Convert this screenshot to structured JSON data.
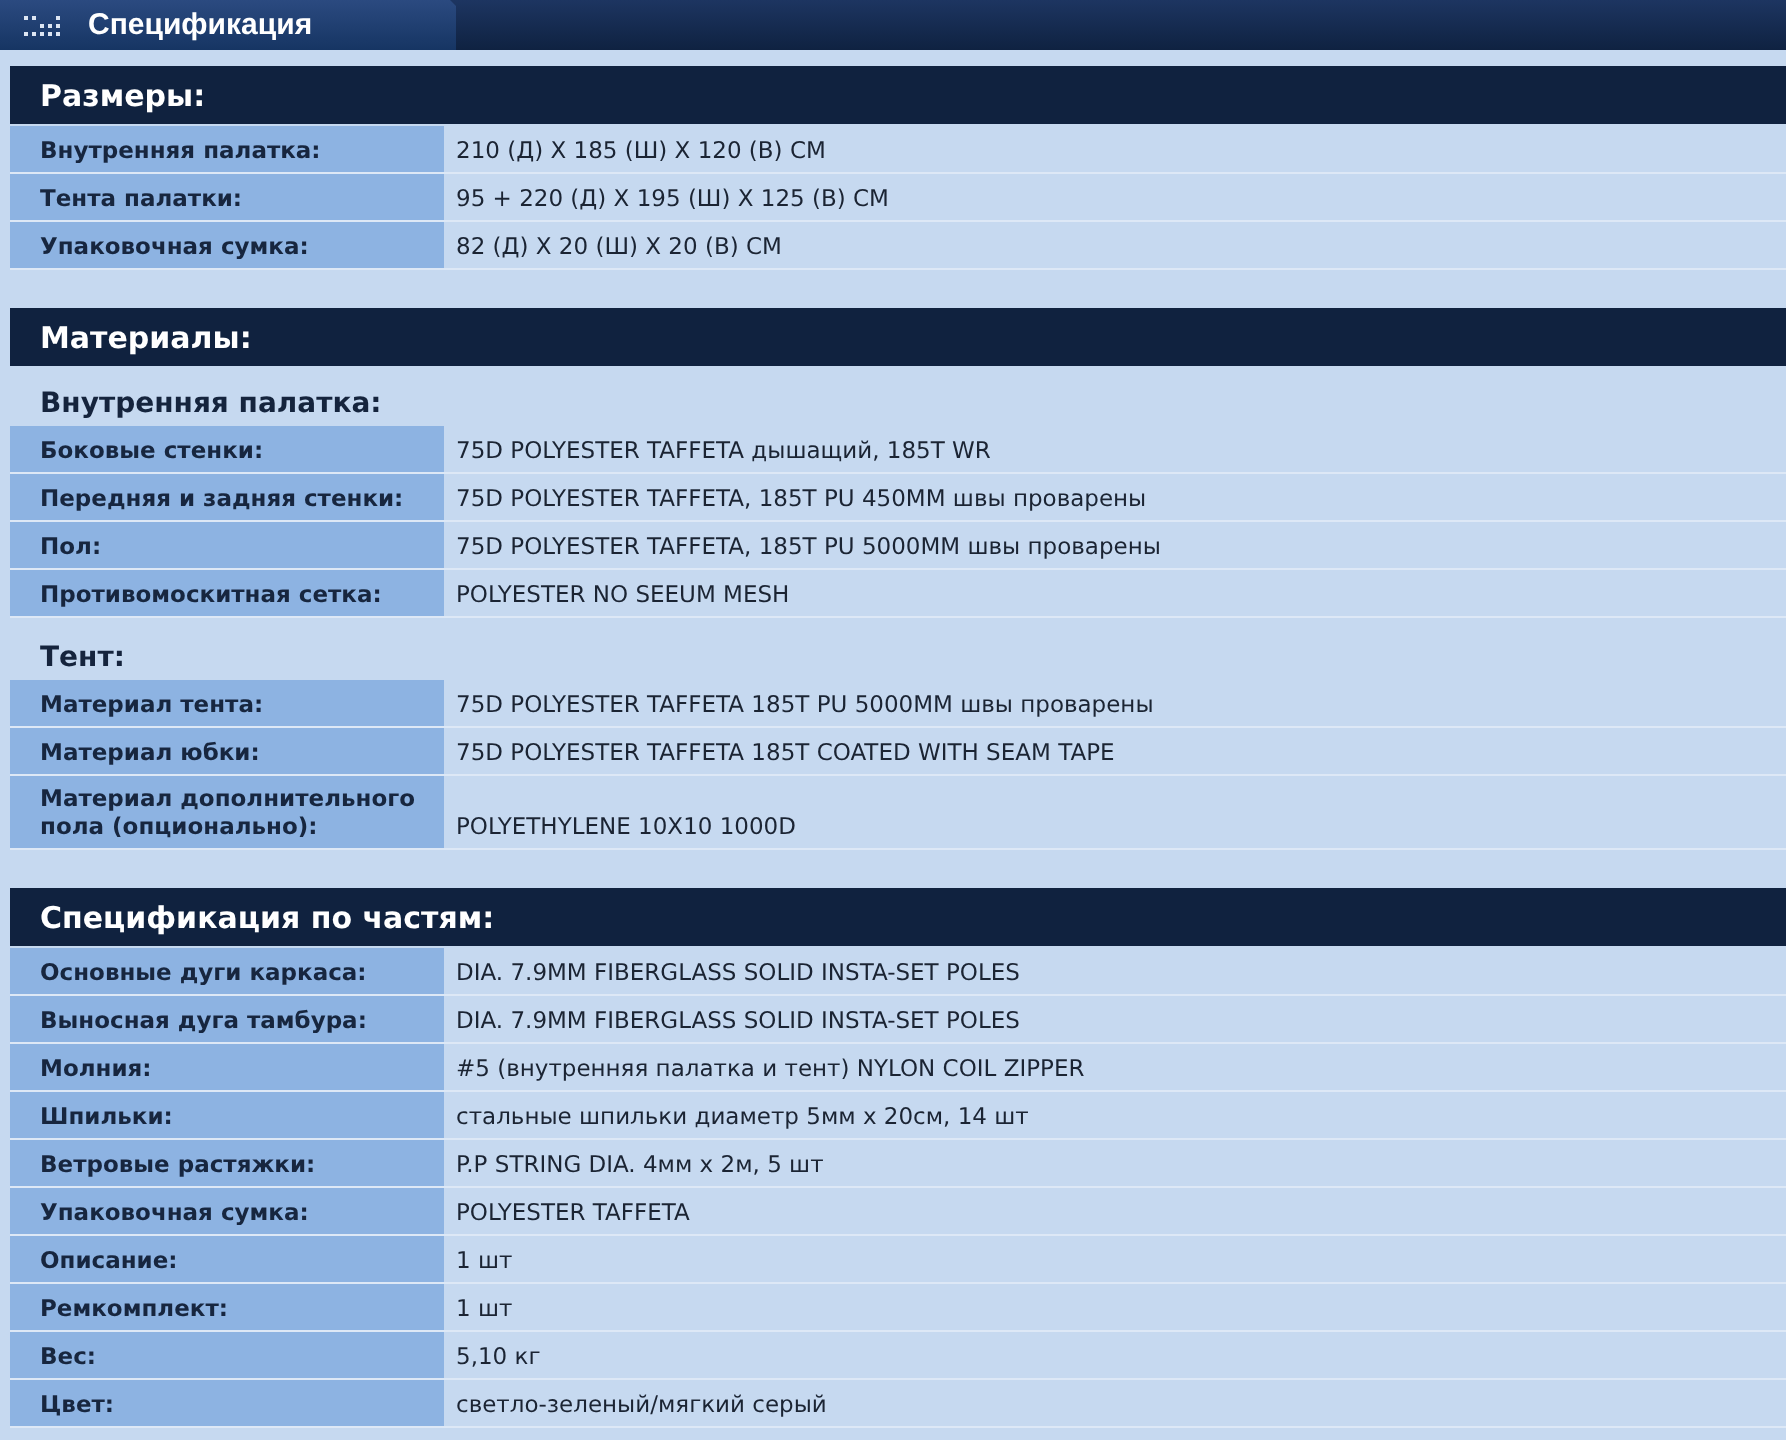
{
  "title_bar": {
    "title": "Спецификация"
  },
  "sections": [
    {
      "title": "Размеры:",
      "groups": [
        {
          "rows": [
            {
              "label": "Внутренняя палатка:",
              "value": "210 (Д) X 185 (Ш) X 120 (В) СМ"
            },
            {
              "label": "Тента палатки:",
              "value": "95 + 220 (Д) X 195 (Ш) X 125 (В) СМ"
            },
            {
              "label": "Упаковочная сумка:",
              "value": "82 (Д) X 20 (Ш) X 20 (В) СМ"
            }
          ]
        }
      ]
    },
    {
      "title": "Материалы:",
      "groups": [
        {
          "subtitle": "Внутренняя палатка:",
          "rows": [
            {
              "label": "Боковые стенки:",
              "value": "75D POLYESTER TAFFETA дышащий, 185T WR"
            },
            {
              "label": "Передняя и задняя стенки:",
              "value": "75D POLYESTER TAFFETA, 185T PU 450MM швы проварены"
            },
            {
              "label": "Пол:",
              "value": "75D POLYESTER TAFFETA, 185T PU 5000MM швы проварены"
            },
            {
              "label": "Противомоскитная сетка:",
              "value": "POLYESTER NO SEEUM MESH"
            }
          ]
        },
        {
          "subtitle": "Тент:",
          "rows": [
            {
              "label": "Материал тента:",
              "value": "75D POLYESTER TAFFETA 185T PU 5000MM швы проварены"
            },
            {
              "label": "Материал юбки:",
              "value": "75D POLYESTER TAFFETA 185T COATED WITH SEAM TAPE"
            },
            {
              "label": "Материал дополнительного пола (опционально):",
              "value": "POLYETHYLENE 10X10 1000D"
            }
          ]
        }
      ]
    },
    {
      "title": "Спецификация по частям:",
      "groups": [
        {
          "rows": [
            {
              "label": "Основные дуги каркаса:",
              "value": "DIA. 7.9MM FIBERGLASS SOLID INSTA-SET POLES"
            },
            {
              "label": "Выносная дуга тамбура:",
              "value": "DIA. 7.9MM FIBERGLASS SOLID INSTA-SET POLES"
            },
            {
              "label": "Молния:",
              "value": "#5 (внутренняя палатка и тент) NYLON COIL ZIPPER"
            },
            {
              "label": "Шпильки:",
              "value": "стальные шпильки диаметр 5мм x 20см, 14 шт"
            },
            {
              "label": "Ветровые растяжки:",
              "value": "P.P STRING DIA. 4мм x 2м, 5 шт"
            },
            {
              "label": "Упаковочная сумка:",
              "value": "POLYESTER TAFFETA"
            },
            {
              "label": "Описание:",
              "value": "1 шт"
            },
            {
              "label": "Ремкомплект:",
              "value": "1 шт"
            },
            {
              "label": "Вес:",
              "value": "5,10 кг"
            },
            {
              "label": "Цвет:",
              "value": "светло-зеленый/мягкий серый"
            }
          ]
        }
      ]
    }
  ]
}
